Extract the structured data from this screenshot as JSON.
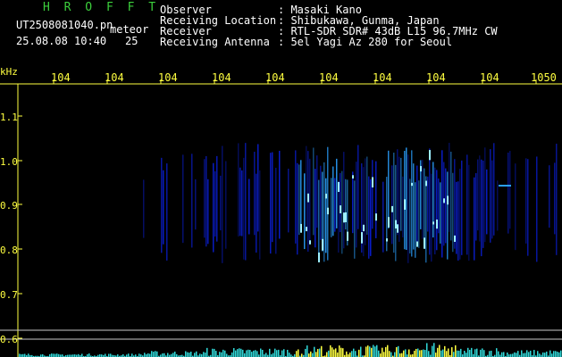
{
  "header": {
    "app_name": "H R O F F T",
    "file_name": "UT2508081040.pn",
    "detection_type": "meteor",
    "timestamp": "25.08.08 10:40",
    "count": "25",
    "fields": [
      {
        "label": "Observer",
        "value": ": Masaki Kano"
      },
      {
        "label": "Receiving Location",
        "value": ": Shibukawa, Gunma, Japan"
      },
      {
        "label": "Receiver",
        "value": ": RTL-SDR SDR# 43dB L15 96.7MHz CW"
      },
      {
        "label": "Receiving Antenna",
        "value": ": 5el Yagi Az 280 for Seoul"
      }
    ]
  },
  "spectrogram": {
    "y_unit": "kHz",
    "y_ticks": [
      "1.1",
      "1.0",
      "0.9",
      "0.8",
      "0.7",
      "0.6"
    ],
    "x_ticks": [
      "104",
      "104",
      "104",
      "104",
      "104",
      "104",
      "104",
      "104",
      "104",
      "1050"
    ],
    "colors": {
      "signal_low": "#0a1ed2",
      "signal_mid": "#2aa0ff",
      "signal_high": "#9ef0ff",
      "axis": "#ffff40",
      "header_green": "#3ccf3c"
    }
  }
}
